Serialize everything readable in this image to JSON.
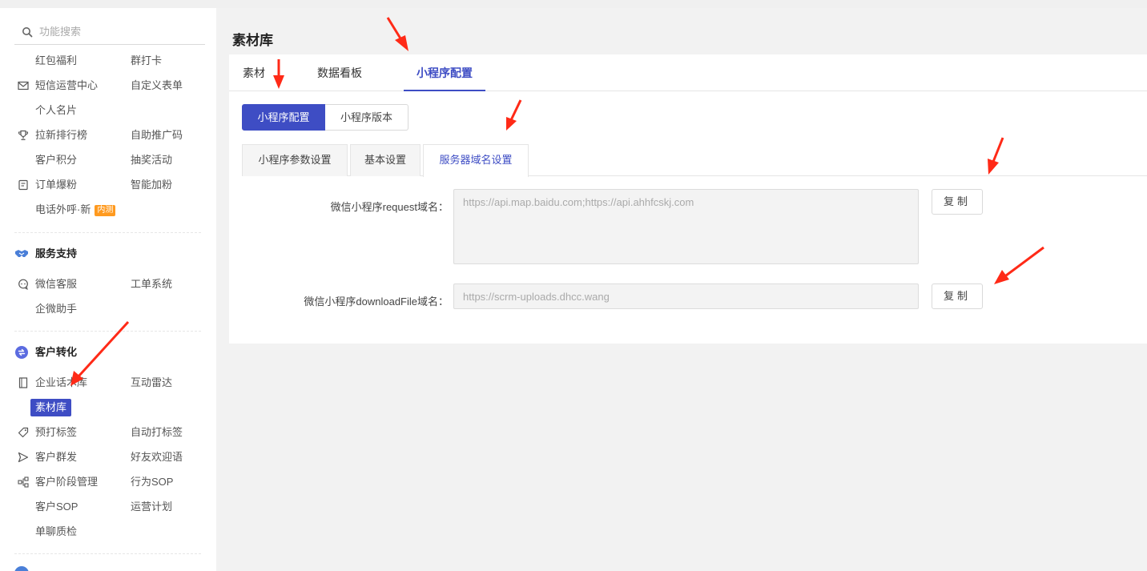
{
  "search": {
    "placeholder": "功能搜索"
  },
  "sidebar": {
    "rows1": [
      {
        "left": "红包福利",
        "right": "群打卡",
        "left_icon": ""
      },
      {
        "left": "短信运营中心",
        "right": "自定义表单",
        "left_icon": "mail-icon"
      },
      {
        "left": "个人名片",
        "right": "",
        "left_icon": ""
      },
      {
        "left": "拉新排行榜",
        "right": "自助推广码",
        "left_icon": "trophy-icon"
      },
      {
        "left": "客户积分",
        "right": "抽奖活动",
        "left_icon": ""
      },
      {
        "left": "订单爆粉",
        "right": "智能加粉",
        "left_icon": "order-icon"
      },
      {
        "left": "电话外呼·新",
        "right": "",
        "left_icon": "",
        "tag": "内测"
      }
    ],
    "section_service": {
      "title": "服务支持",
      "icon": "handshake-icon",
      "rows": [
        {
          "left": "微信客服",
          "right": "工单系统",
          "left_icon": "chat-icon"
        },
        {
          "left": "企微助手",
          "right": "",
          "left_icon": ""
        }
      ]
    },
    "section_convert": {
      "title": "客户转化",
      "icon": "convert-icon",
      "rows": [
        {
          "left": "企业话术库",
          "right": "互动雷达",
          "left_icon": "book-icon"
        },
        {
          "left": "素材库",
          "right": "",
          "left_icon": "",
          "active": true
        },
        {
          "left": "预打标签",
          "right": "自动打标签",
          "left_icon": "tag-icon"
        },
        {
          "left": "客户群发",
          "right": "好友欢迎语",
          "left_icon": "send-icon"
        },
        {
          "left": "客户阶段管理",
          "right": "行为SOP",
          "left_icon": "flow-icon"
        },
        {
          "left": "客户SOP",
          "right": "运营计划",
          "left_icon": ""
        },
        {
          "left": "单聊质检",
          "right": "",
          "left_icon": ""
        }
      ]
    }
  },
  "main": {
    "title": "素材库",
    "tabs": [
      "素材",
      "数据看板",
      "小程序配置"
    ],
    "active_tab": 2,
    "segment": [
      "小程序配置",
      "小程序版本"
    ],
    "subtabs": [
      "小程序参数设置",
      "基本设置",
      "服务器域名设置"
    ],
    "active_subtab": 2,
    "fields": [
      {
        "label": "微信小程序request域名：",
        "value": "https://api.map.baidu.com;https://api.ahhfcskj.com",
        "button": "复制"
      },
      {
        "label": "微信小程序downloadFile域名：",
        "value": "https://scrm-uploads.dhcc.wang",
        "button": "复制"
      }
    ]
  },
  "colors": {
    "accent": "#3e4dc4",
    "arrow": "#ff2a17",
    "tag": "#ff9a1f"
  }
}
